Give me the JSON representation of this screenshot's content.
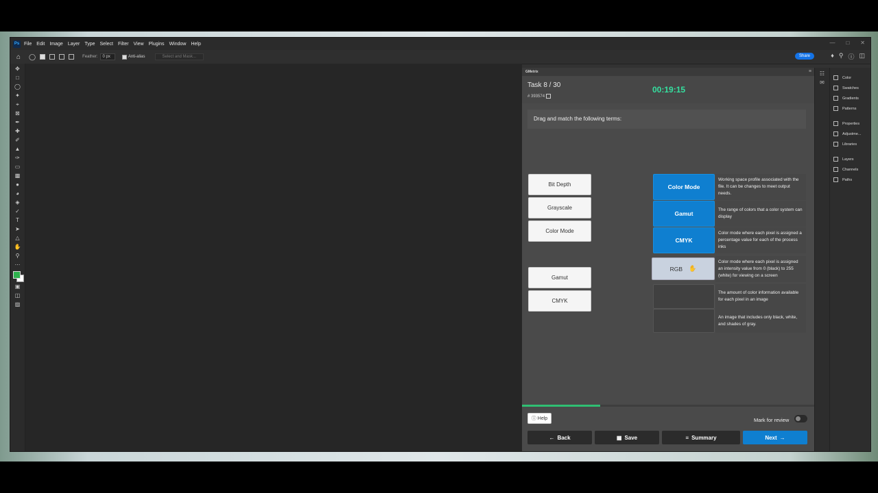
{
  "menubar": {
    "logo": "Ps",
    "items": [
      "File",
      "Edit",
      "Image",
      "Layer",
      "Type",
      "Select",
      "Filter",
      "View",
      "Plugins",
      "Window",
      "Help"
    ]
  },
  "options": {
    "feather_label": "Feather:",
    "feather_value": "0 px",
    "antialias_label": "Anti-alias",
    "select_mask_label": "Select and Mask...",
    "share_label": "Share"
  },
  "plugin": {
    "tab_label": "GMetrix",
    "task_label": "Task 8 / 30",
    "task_id": "# 393574",
    "timer": "00:19:15",
    "instruction": "Drag and match the following terms:",
    "terms": [
      "Bit Depth",
      "Grayscale",
      "Color Mode",
      "Gamut",
      "CMYK"
    ],
    "slots": [
      {
        "value": "Color Mode",
        "definition": "Working space profile associated with the file. It can be changes to meet output needs."
      },
      {
        "value": "Gamut",
        "definition": "The range of colors that a color system can display"
      },
      {
        "value": "CMYK",
        "definition": "Color mode where each pixel is assigned a percentage value for each of the process inks"
      },
      {
        "value": "RGB",
        "definition": "Color mode where each pixel is assigned an intensity value from 0 (black) to 255 (white) for viewing on a screen"
      },
      {
        "value": "",
        "definition": "The amount of color information available for each pixel in an image"
      },
      {
        "value": "",
        "definition": "An image that includes only black, white, and shades of gray."
      }
    ],
    "progress_fraction": 0.267,
    "help_label": "Help",
    "review_label": "Mark for review",
    "nav": {
      "back": "Back",
      "save": "Save",
      "summary": "Summary",
      "next": "Next"
    }
  },
  "right_panel": {
    "group1": [
      "Color",
      "Swatches",
      "Gradients",
      "Patterns"
    ],
    "group2": [
      "Properties",
      "Adjustme...",
      "Libraries"
    ],
    "group3": [
      "Layers",
      "Channels",
      "Paths"
    ]
  },
  "colors": {
    "accent": "#0f7fd0",
    "timer": "#35e0a0",
    "progress": "#2fbf73",
    "foreground_swatch": "#2fb14e"
  }
}
